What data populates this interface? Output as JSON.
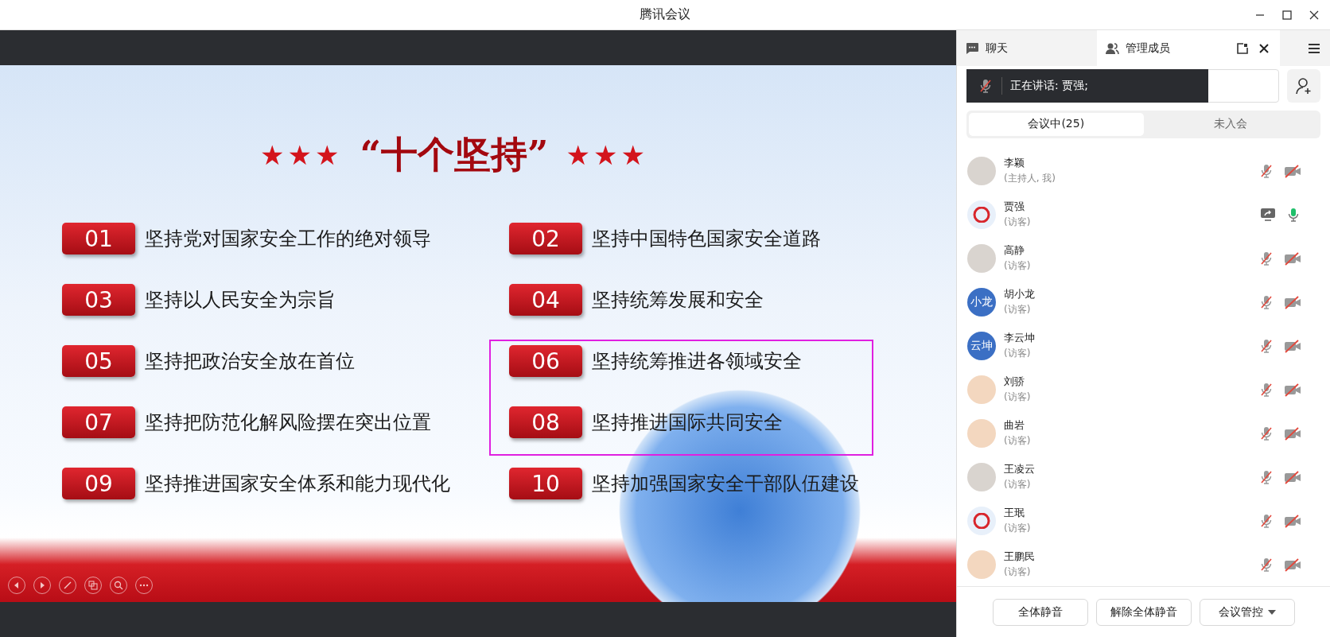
{
  "window": {
    "title": "腾讯会议"
  },
  "slide": {
    "title_left": "★★★",
    "title": "“十个坚持”",
    "title_right": "★★★",
    "items": [
      {
        "number": "01",
        "text": "坚持党对国家安全工作的绝对领导"
      },
      {
        "number": "02",
        "text": "坚持中国特色国家安全道路"
      },
      {
        "number": "03",
        "text": "坚持以人民安全为宗旨"
      },
      {
        "number": "04",
        "text": "坚持统筹发展和安全"
      },
      {
        "number": "05",
        "text": "坚持把政治安全放在首位"
      },
      {
        "number": "06",
        "text": "坚持统筹推进各领域安全"
      },
      {
        "number": "07",
        "text": "坚持把防范化解风险摆在突出位置"
      },
      {
        "number": "08",
        "text": "坚持推进国际共同安全"
      },
      {
        "number": "09",
        "text": "坚持推进国家安全体系和能力现代化"
      },
      {
        "number": "10",
        "text": "坚持加强国家安全干部队伍建设"
      }
    ]
  },
  "panel": {
    "tabs": [
      {
        "kind": "chat",
        "label": "聊天",
        "selected": false
      },
      {
        "kind": "members",
        "label": "管理成员",
        "selected": true
      }
    ],
    "speaking": {
      "label": "正在讲话:",
      "name": "贾强;"
    },
    "member_tabs": [
      {
        "label": "会议中(25)",
        "selected": true
      },
      {
        "label": "未入会",
        "selected": false
      }
    ],
    "members": [
      {
        "name": "李颖",
        "role": "(主持人, 我)",
        "avatar": {
          "kind": "photo"
        },
        "sharing": false,
        "mic_on": false,
        "camera_on": false
      },
      {
        "name": "贾强",
        "role": "(访客)",
        "avatar": {
          "kind": "logo"
        },
        "sharing": true,
        "mic_on": true
      },
      {
        "name": "高静",
        "role": "(访客)",
        "avatar": {
          "kind": "photo"
        },
        "sharing": false,
        "mic_on": false,
        "camera_on": false
      },
      {
        "name": "胡小龙",
        "role": "(访客)",
        "avatar": {
          "kind": "initials",
          "text": "小龙"
        },
        "sharing": false,
        "mic_on": false,
        "camera_on": false
      },
      {
        "name": "李云坤",
        "role": "(访客)",
        "avatar": {
          "kind": "initials",
          "text": "云坤"
        },
        "sharing": false,
        "mic_on": false,
        "camera_on": false
      },
      {
        "name": "刘骄",
        "role": "(访客)",
        "avatar": {
          "kind": "cartoon"
        },
        "sharing": false,
        "mic_on": false,
        "camera_on": false
      },
      {
        "name": "曲岩",
        "role": "(访客)",
        "avatar": {
          "kind": "cartoon"
        },
        "sharing": false,
        "mic_on": false,
        "camera_on": false
      },
      {
        "name": "王凌云",
        "role": "(访客)",
        "avatar": {
          "kind": "photo"
        },
        "sharing": false,
        "mic_on": false,
        "camera_on": false
      },
      {
        "name": "王珉",
        "role": "(访客)",
        "avatar": {
          "kind": "logo"
        },
        "sharing": false,
        "mic_on": false,
        "camera_on": false
      },
      {
        "name": "王鹏民",
        "role": "(访客)",
        "avatar": {
          "kind": "cartoon"
        },
        "sharing": false,
        "mic_on": false,
        "camera_on": false
      }
    ],
    "buttons": [
      {
        "kind": "plain",
        "label": "全体静音"
      },
      {
        "kind": "plain",
        "label": "解除全体静音"
      },
      {
        "kind": "dropdown",
        "label": "会议管控"
      }
    ]
  }
}
